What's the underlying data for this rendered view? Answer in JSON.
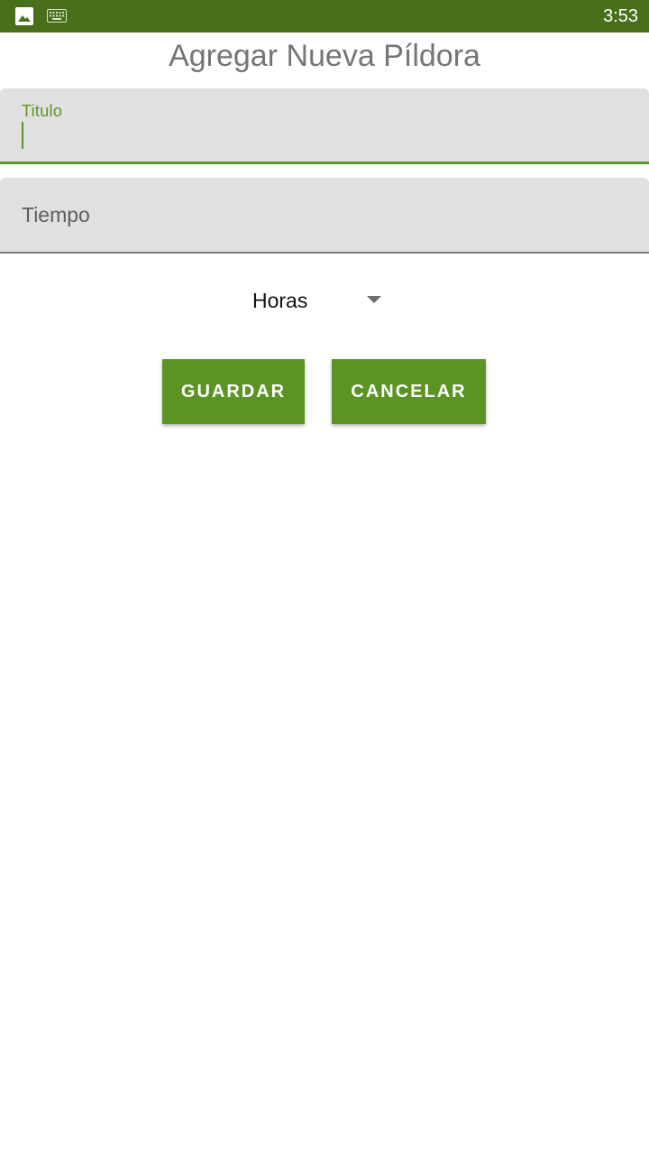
{
  "status_bar": {
    "time": "3:53",
    "background_color": "#4a6f1c",
    "icons": [
      "image-icon",
      "keyboard-icon"
    ]
  },
  "page": {
    "title": "Agregar Nueva Píldora"
  },
  "form": {
    "titulo_field": {
      "label": "Titulo",
      "value": "",
      "focused": true
    },
    "tiempo_field": {
      "label": "Tiempo",
      "value": ""
    },
    "unit_spinner": {
      "selected": "Horas"
    }
  },
  "buttons": {
    "save_label": "GUARDAR",
    "cancel_label": "CANCELAR"
  },
  "colors": {
    "accent": "#5c9424",
    "field_background": "#e0e0e0"
  }
}
